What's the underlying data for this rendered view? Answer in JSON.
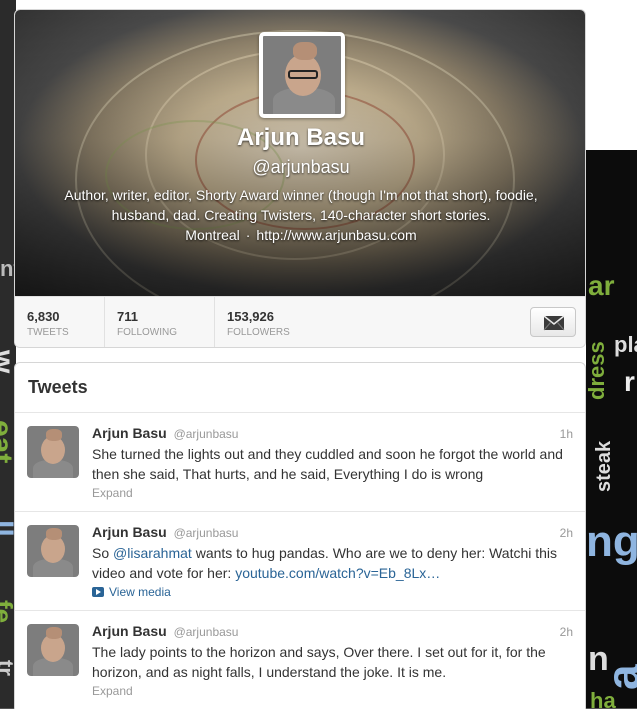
{
  "profile": {
    "name": "Arjun Basu",
    "handle": "@arjunbasu",
    "bio": "Author, writer, editor, Shorty Award winner (though I'm not that short), foodie, husband, dad. Creating Twisters, 140-character short stories.",
    "location": "Montreal",
    "separator": "·",
    "website": "http://www.arjunbasu.com"
  },
  "stats": {
    "tweets": {
      "value": "6,830",
      "label": "TWEETS"
    },
    "following": {
      "value": "711",
      "label": "FOLLOWING"
    },
    "followers": {
      "value": "153,926",
      "label": "FOLLOWERS"
    }
  },
  "message_button": {
    "icon": "envelope-icon"
  },
  "tweets_section": {
    "title": "Tweets",
    "items": [
      {
        "name": "Arjun Basu",
        "handle": "@arjunbasu",
        "time": "1h",
        "text": "She turned the lights out and they cuddled and soon he forgot the world and then she said, That hurts, and he said, Everything I do is wrong",
        "action": "Expand"
      },
      {
        "name": "Arjun Basu",
        "handle": "@arjunbasu",
        "time": "2h",
        "text_before": "So ",
        "mention": "@lisarahmat",
        "text_middle": " wants to hug pandas. Who are we to deny her: Watchi this video and vote for her: ",
        "link": "youtube.com/watch?v=Eb_8Lx…",
        "action": "View media"
      },
      {
        "name": "Arjun Basu",
        "handle": "@arjunbasu",
        "time": "2h",
        "text": "The lady points to the horizon and says, Over there. I set out for it, for the horizon, and as night falls, I understand the joke. It is me.",
        "action": "Expand"
      }
    ]
  },
  "wallpaper_words": [
    "nt",
    "w",
    "eat",
    "ll",
    "ar",
    "dress",
    "steak",
    "pla",
    "r",
    "ng",
    "a",
    "n",
    "ha",
    "fe",
    "tr"
  ],
  "colors": {
    "link": "#2a6496",
    "muted": "#999999",
    "wall_green": "#7fae3c",
    "wall_blue": "#8fb5e0"
  }
}
